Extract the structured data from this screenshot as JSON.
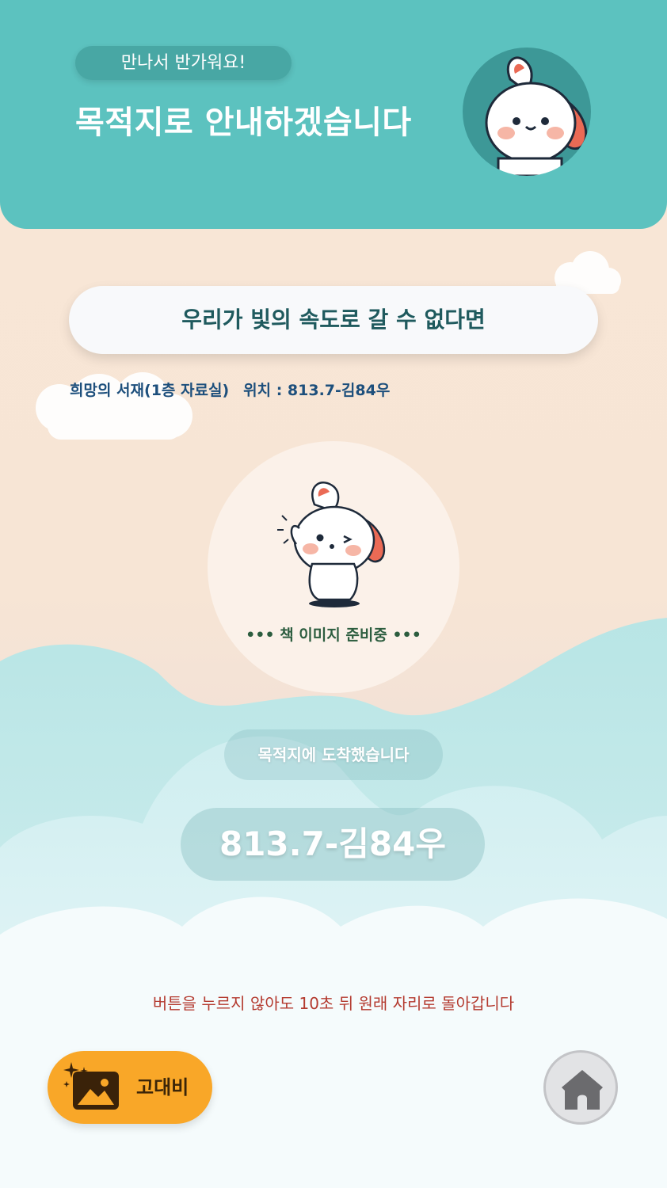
{
  "header": {
    "greeting": "만나서 반가워요!",
    "title": "목적지로 안내하겠습니다"
  },
  "book": {
    "title": "우리가 빛의 속도로 갈 수 없다면",
    "room": "희망의 서재(1층 자료실)",
    "location": "위치 : 813.7-김84우",
    "image_status": "••• 책 이미지 준비중 •••"
  },
  "arrival": {
    "message": "목적지에 도착했습니다",
    "call_number": "813.7-김84우"
  },
  "footer": {
    "notice": "버튼을 누르지 않아도 10초 뒤 원래 자리로 돌아갑니다",
    "contrast_label": "고대비",
    "contrast_icon": "contrast-image-icon",
    "home_icon": "home-icon"
  },
  "colors": {
    "header": "#5cc2bf",
    "greeting_pill": "#48a7a4",
    "contrast_button": "#f9a728",
    "notice_text": "#b43a2f",
    "location_text": "#1d4f7c"
  }
}
